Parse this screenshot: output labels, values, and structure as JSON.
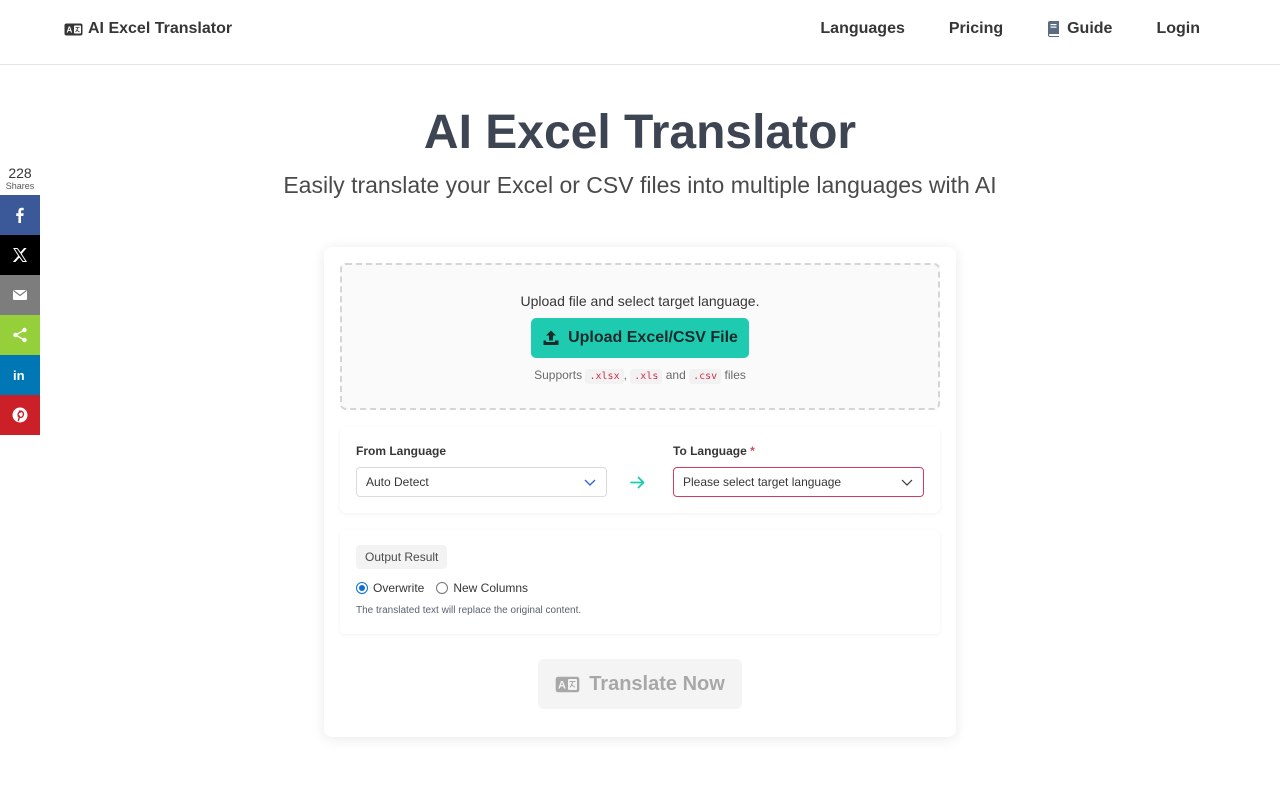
{
  "header": {
    "brand": "AI Excel Translator",
    "nav": [
      {
        "label": "Languages"
      },
      {
        "label": "Pricing"
      },
      {
        "label": "Guide"
      },
      {
        "label": "Login"
      }
    ]
  },
  "hero": {
    "title": "AI Excel Translator",
    "subtitle": "Easily translate your Excel or CSV files into multiple languages with AI"
  },
  "share": {
    "count": "228",
    "count_label": "Shares",
    "networks": [
      "facebook-icon",
      "x-icon",
      "email-icon",
      "share-icon",
      "linkedin-icon",
      "pinterest-icon"
    ],
    "colors": {
      "facebook": "#3b5998",
      "x": "#000000",
      "email": "#7d7d7d",
      "share": "#95d03a",
      "linkedin": "#0077b5",
      "pinterest": "#cb2027"
    }
  },
  "upload": {
    "instruction": "Upload file and select target language.",
    "button_label": "Upload Excel/CSV File",
    "supports_prefix": "Supports",
    "ext_xlsx": ".xlsx",
    "comma": ",",
    "ext_xls": ".xls",
    "and": "and",
    "ext_csv": ".csv",
    "supports_suffix": "files"
  },
  "languages": {
    "from_label": "From Language",
    "from_value": "Auto Detect",
    "to_label": "To Language",
    "required_mark": "*",
    "to_placeholder": "Please select target language"
  },
  "output": {
    "tag": "Output Result",
    "options": [
      {
        "label": "Overwrite",
        "checked": true
      },
      {
        "label": "New Columns",
        "checked": false
      }
    ],
    "hint": "The translated text will replace the original content."
  },
  "translate": {
    "button_label": "Translate Now",
    "disabled": true
  },
  "colors": {
    "accent": "#1ecbb1",
    "danger": "#d63a5e",
    "title": "#3d4452"
  }
}
